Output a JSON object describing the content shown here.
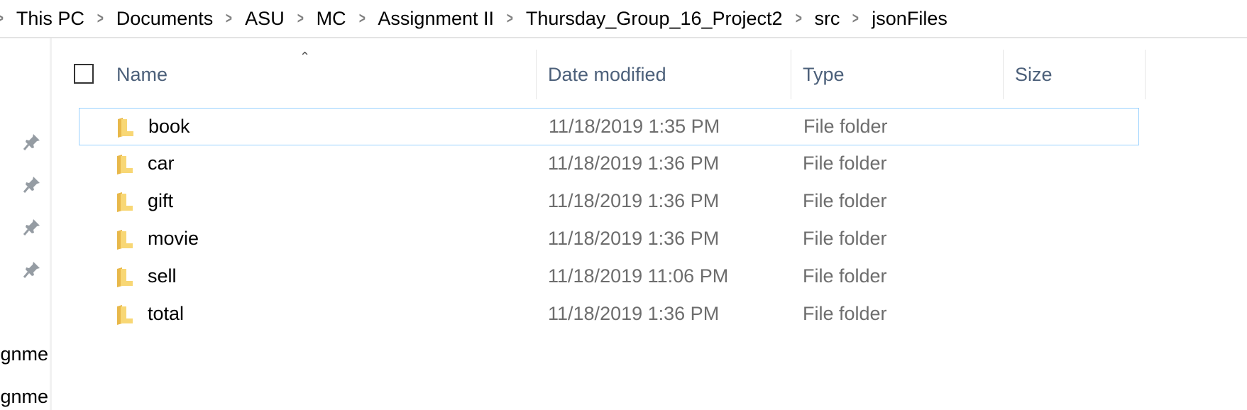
{
  "breadcrumb": [
    "This PC",
    "Documents",
    "ASU",
    "MC",
    "Assignment II",
    "Thursday_Group_16_Project2",
    "src",
    "jsonFiles"
  ],
  "nav_pane": {
    "partial_items": [
      "Assignme",
      "Assignme"
    ]
  },
  "columns": {
    "name": "Name",
    "date": "Date modified",
    "type": "Type",
    "size": "Size"
  },
  "sort": {
    "column": "Name",
    "direction": "ascending"
  },
  "rows": [
    {
      "name": "book",
      "date": "11/18/2019 1:35 PM",
      "type": "File folder",
      "selected": true
    },
    {
      "name": "car",
      "date": "11/18/2019 1:36 PM",
      "type": "File folder"
    },
    {
      "name": "gift",
      "date": "11/18/2019 1:36 PM",
      "type": "File folder"
    },
    {
      "name": "movie",
      "date": "11/18/2019 1:36 PM",
      "type": "File folder"
    },
    {
      "name": "sell",
      "date": "11/18/2019 11:06 PM",
      "type": "File folder"
    },
    {
      "name": "total",
      "date": "11/18/2019 1:36 PM",
      "type": "File folder"
    }
  ],
  "colors": {
    "selection_border": "#99d1ff",
    "header_text": "#4c607a",
    "folder": "#f8d775"
  }
}
